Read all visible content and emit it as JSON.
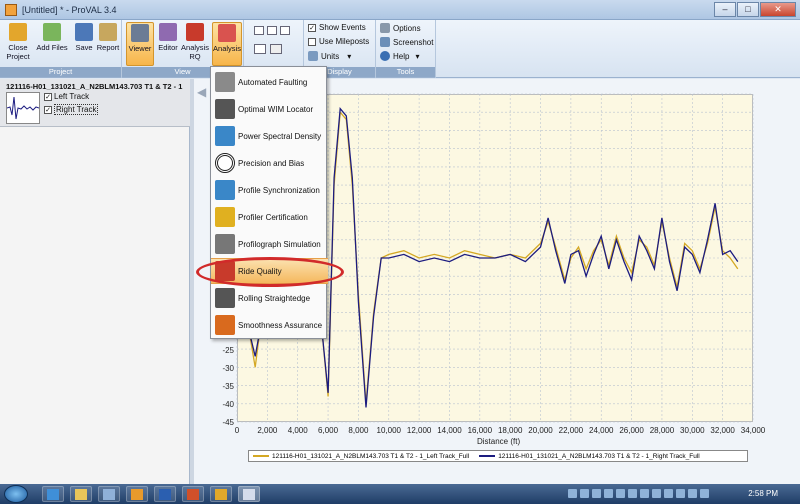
{
  "window": {
    "title": "[Untitled] * - ProVAL 3.4",
    "buttons": [
      "–",
      "□",
      "✕"
    ]
  },
  "ribbon": {
    "buttons": [
      {
        "label": "Close\nProject",
        "icon": "folder-close-icon",
        "color": "#e3a62c"
      },
      {
        "label": "Add Files",
        "icon": "add-file-icon",
        "color": "#7ab55c"
      },
      {
        "label": "Save",
        "icon": "save-icon",
        "color": "#4c78b8"
      },
      {
        "label": "Report",
        "icon": "report-icon",
        "color": "#c7a75e"
      },
      {
        "label": "Viewer",
        "icon": "viewer-icon",
        "color": "#6b7c95",
        "active": true
      },
      {
        "label": "Editor",
        "icon": "editor-icon",
        "color": "#8f6ab0"
      },
      {
        "label": "Analysis\nRQ",
        "icon": "car-icon",
        "color": "#c83a2b"
      },
      {
        "label": "Analysis",
        "icon": "analysis-bars-icon",
        "color": "#d9534f",
        "active": true
      }
    ],
    "groups": {
      "project": "Project",
      "view": "View",
      "display": "Display",
      "tools": "Tools"
    },
    "display": {
      "show_events": "Show Events",
      "use_mileposts": "Use Mileposts",
      "units": "Units"
    },
    "tools": {
      "options": "Options",
      "screenshot": "Screenshot",
      "help": "Help"
    }
  },
  "track": {
    "name": "121116-H01_131021_A_N2BLM143.703 T1 & T2 - 1",
    "left": "Left Track",
    "right": "Right Track"
  },
  "menu": {
    "items": [
      {
        "label": "Automated Faulting",
        "icon": "faulting-icon",
        "color": "#8a8a8a"
      },
      {
        "label": "Optimal WIM Locator",
        "icon": "wim-locator-icon",
        "color": "#555555"
      },
      {
        "label": "Power Spectral Density",
        "icon": "psd-icon",
        "color": "#3a87c8"
      },
      {
        "label": "Precision and Bias",
        "icon": "target-icon",
        "color": "#222222"
      },
      {
        "label": "Profile Synchronization",
        "icon": "sync-icon",
        "color": "#3a87c8"
      },
      {
        "label": "Profiler Certification",
        "icon": "ribbon-award-icon",
        "color": "#e0b020"
      },
      {
        "label": "Profilograph Simulation",
        "icon": "profilograph-icon",
        "color": "#777777"
      },
      {
        "label": "Ride Quality",
        "icon": "car-icon",
        "color": "#c83a2b",
        "highlighted": true
      },
      {
        "label": "Rolling Straightedge",
        "icon": "straightedge-icon",
        "color": "#555555"
      },
      {
        "label": "Smoothness Assurance",
        "icon": "puzzle-icon",
        "color": "#d96a1e"
      }
    ]
  },
  "taskbar": {
    "time": "2:58 PM"
  },
  "chart_data": {
    "type": "line",
    "xlabel": "Distance (ft)",
    "xlim": [
      0,
      34000
    ],
    "ylim": [
      -45,
      45
    ],
    "xticks": [
      "0",
      "2,000",
      "4,000",
      "6,000",
      "8,000",
      "10,000",
      "12,000",
      "14,000",
      "16,000",
      "18,000",
      "20,000",
      "22,000",
      "24,000",
      "26,000",
      "28,000",
      "30,000",
      "32,000",
      "34,000"
    ],
    "yticks_visible": [
      "-25",
      "-30",
      "-35",
      "-40",
      "-45"
    ],
    "series": [
      {
        "name": "121116-H01_131021_A_N2BLM143.703 T1 & T2 - 1_Left Track_Full",
        "color": "#d4a824",
        "x": [
          0,
          800,
          1200,
          1500,
          2000,
          3000,
          4000,
          5000,
          5600,
          6000,
          6400,
          6800,
          7200,
          7600,
          8000,
          8500,
          9000,
          9500,
          10000,
          11000,
          12000,
          13000,
          14000,
          15000,
          16000,
          17000,
          18000,
          19000,
          20000,
          20500,
          21000,
          21600,
          22000,
          22500,
          23000,
          23500,
          24000,
          24500,
          25000,
          25500,
          26000,
          26500,
          27000,
          27500,
          28000,
          28500,
          29000,
          29500,
          30000,
          30500,
          31000,
          31500,
          32000,
          32500,
          33000
        ],
        "y": [
          -10,
          -20,
          -30,
          -20,
          -5,
          0,
          2,
          0,
          -20,
          -38,
          20,
          40,
          38,
          20,
          -10,
          -40,
          -15,
          0,
          1,
          2,
          0,
          1,
          0,
          2,
          1,
          0,
          1,
          0,
          4,
          10,
          3,
          -6,
          0,
          3,
          -3,
          2,
          5,
          -2,
          6,
          0,
          -4,
          5,
          3,
          -2,
          10,
          0,
          -8,
          4,
          2,
          -3,
          4,
          14,
          2,
          0,
          -3
        ]
      },
      {
        "name": "121116-H01_131021_A_N2BLM143.703 T1 & T2 - 1_Right Track_Full",
        "color": "#1c1c80",
        "x": [
          0,
          800,
          1200,
          1500,
          2000,
          3000,
          4000,
          5000,
          5600,
          6000,
          6400,
          6800,
          7200,
          7600,
          8000,
          8500,
          9000,
          9500,
          10000,
          11000,
          12000,
          13000,
          14000,
          15000,
          16000,
          17000,
          18000,
          19000,
          20000,
          20500,
          21000,
          21600,
          22000,
          22500,
          23000,
          23500,
          24000,
          24500,
          25000,
          25500,
          26000,
          26500,
          27000,
          27500,
          28000,
          28500,
          29000,
          29500,
          30000,
          30500,
          31000,
          31500,
          32000,
          32500,
          33000
        ],
        "y": [
          -10,
          -20,
          -27,
          -20,
          -5,
          0,
          1,
          0,
          -20,
          -37,
          22,
          41,
          39,
          22,
          -12,
          -41,
          -16,
          0,
          0,
          1,
          -1,
          0,
          -1,
          1,
          0,
          0,
          1,
          -1,
          3,
          11,
          2,
          -7,
          1,
          2,
          -5,
          1,
          6,
          -3,
          5,
          -1,
          -6,
          6,
          2,
          -3,
          11,
          -1,
          -9,
          3,
          1,
          -4,
          5,
          15,
          1,
          2,
          -1
        ]
      }
    ]
  }
}
